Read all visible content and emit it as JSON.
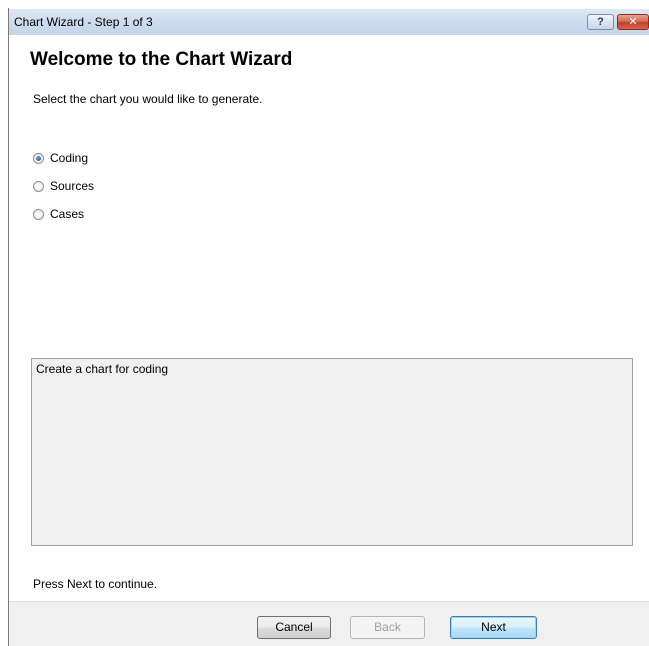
{
  "window": {
    "title": "Chart Wizard - Step 1 of 3",
    "help_label": "?",
    "close_label": "✕"
  },
  "main": {
    "heading": "Welcome to the Chart Wizard",
    "instruction": "Select the chart you would like to generate.",
    "options": [
      {
        "label": "Coding",
        "selected": true
      },
      {
        "label": "Sources",
        "selected": false
      },
      {
        "label": "Cases",
        "selected": false
      }
    ],
    "description": "Create a chart for coding",
    "continue_hint": "Press Next to continue."
  },
  "footer": {
    "cancel_label": "Cancel",
    "back_label": "Back",
    "next_label": "Next"
  }
}
